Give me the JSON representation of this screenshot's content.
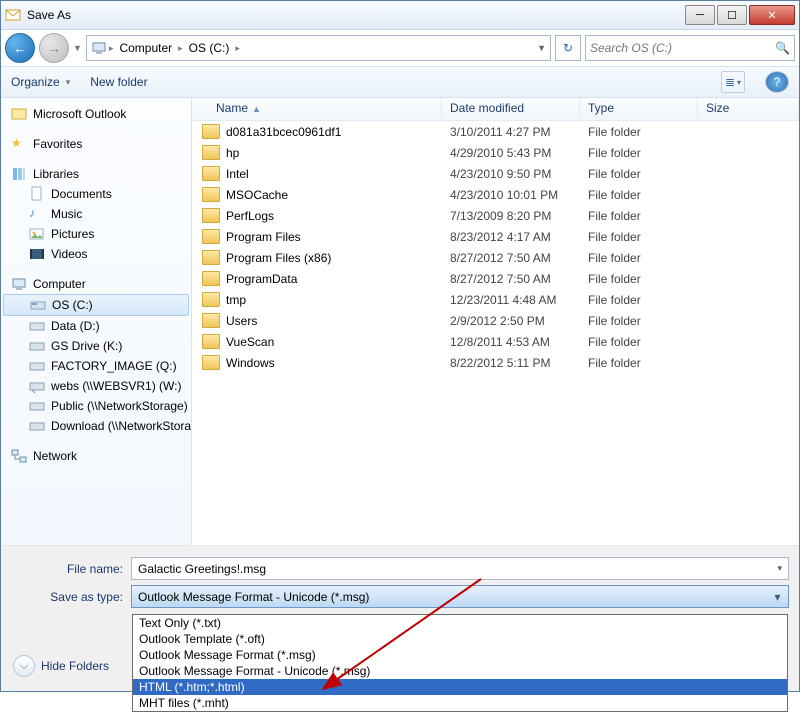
{
  "title": "Save As",
  "breadcrumb": {
    "seg1": "Computer",
    "seg2": "OS (C:)"
  },
  "search_placeholder": "Search OS (C:)",
  "toolbar": {
    "organize": "Organize",
    "newfolder": "New folder"
  },
  "nav": {
    "outlook": "Microsoft Outlook",
    "favorites": "Favorites",
    "libraries": "Libraries",
    "docs": "Documents",
    "music": "Music",
    "pictures": "Pictures",
    "videos": "Videos",
    "computer": "Computer",
    "osc": "OS (C:)",
    "datad": "Data (D:)",
    "gsd": "GS Drive (K:)",
    "factory": "FACTORY_IMAGE (Q:)",
    "webs": "webs (\\\\WEBSVR1) (W:)",
    "public": "Public (\\\\NetworkStorage)",
    "download": "Download (\\\\NetworkStorage)",
    "network": "Network"
  },
  "cols": {
    "name": "Name",
    "date": "Date modified",
    "type": "Type",
    "size": "Size"
  },
  "rows": [
    {
      "name": "d081a31bcec0961df1",
      "date": "3/10/2011 4:27 PM",
      "type": "File folder"
    },
    {
      "name": "hp",
      "date": "4/29/2010 5:43 PM",
      "type": "File folder"
    },
    {
      "name": "Intel",
      "date": "4/23/2010 9:50 PM",
      "type": "File folder"
    },
    {
      "name": "MSOCache",
      "date": "4/23/2010 10:01 PM",
      "type": "File folder"
    },
    {
      "name": "PerfLogs",
      "date": "7/13/2009 8:20 PM",
      "type": "File folder"
    },
    {
      "name": "Program Files",
      "date": "8/23/2012 4:17 AM",
      "type": "File folder"
    },
    {
      "name": "Program Files (x86)",
      "date": "8/27/2012 7:50 AM",
      "type": "File folder"
    },
    {
      "name": "ProgramData",
      "date": "8/27/2012 7:50 AM",
      "type": "File folder"
    },
    {
      "name": "tmp",
      "date": "12/23/2011 4:48 AM",
      "type": "File folder"
    },
    {
      "name": "Users",
      "date": "2/9/2012 2:50 PM",
      "type": "File folder"
    },
    {
      "name": "VueScan",
      "date": "12/8/2011 4:53 AM",
      "type": "File folder"
    },
    {
      "name": "Windows",
      "date": "8/22/2012 5:11 PM",
      "type": "File folder"
    }
  ],
  "labels": {
    "filename": "File name:",
    "saveastype": "Save as type:",
    "hidefolders": "Hide Folders"
  },
  "filename_value": "Galactic Greetings!.msg",
  "saveastype_value": "Outlook Message Format - Unicode (*.msg)",
  "dropdown": [
    {
      "label": "Text Only (*.txt)",
      "sel": false
    },
    {
      "label": "Outlook Template (*.oft)",
      "sel": false
    },
    {
      "label": "Outlook Message Format (*.msg)",
      "sel": false
    },
    {
      "label": "Outlook Message Format - Unicode (*.msg)",
      "sel": false
    },
    {
      "label": "HTML (*.htm;*.html)",
      "sel": true
    },
    {
      "label": "MHT files (*.mht)",
      "sel": false
    }
  ]
}
